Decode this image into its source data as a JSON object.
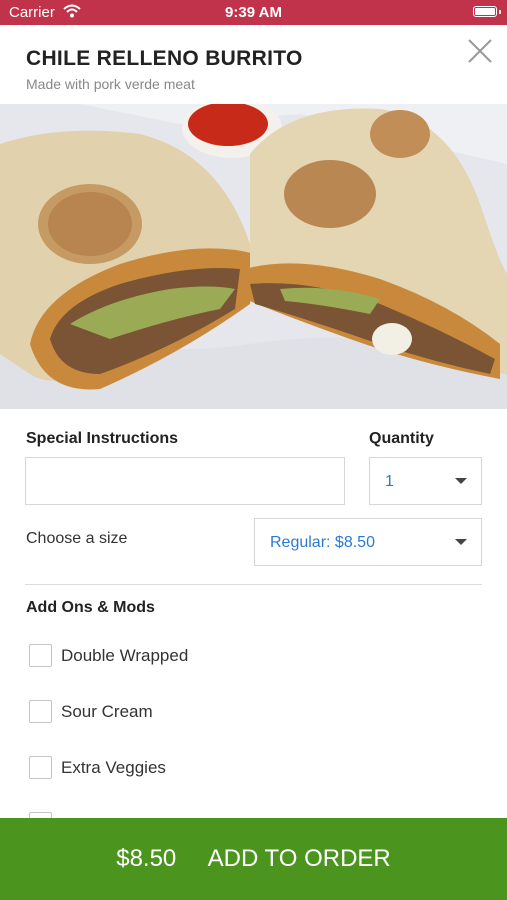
{
  "status_bar": {
    "carrier": "Carrier",
    "time": "9:39 AM"
  },
  "item": {
    "title": "CHILE RELLENO BURRITO",
    "subtitle": "Made with pork verde meat"
  },
  "special_instructions": {
    "label": "Special Instructions",
    "value": ""
  },
  "quantity": {
    "label": "Quantity",
    "value": "1"
  },
  "size": {
    "label": "Choose a size",
    "value": "Regular: $8.50"
  },
  "addons": {
    "heading": "Add Ons & Mods",
    "items": [
      {
        "label": "Double Wrapped",
        "checked": false
      },
      {
        "label": "Sour Cream",
        "checked": false
      },
      {
        "label": "Extra Veggies",
        "checked": false
      }
    ]
  },
  "order": {
    "price": "$8.50",
    "label": "ADD TO ORDER"
  },
  "colors": {
    "status_bar": "#c0334a",
    "order_bar": "#4b951f",
    "select_text": "#2a7ad6"
  }
}
